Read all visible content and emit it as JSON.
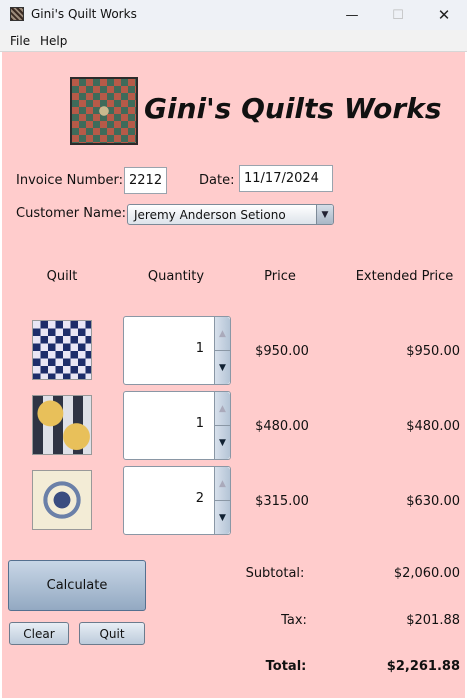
{
  "window": {
    "title": "Gini's Quilt Works"
  },
  "menu": [
    "File",
    "Help"
  ],
  "brand": {
    "title": "Gini's Quilts Works"
  },
  "invoice": {
    "number_label": "Invoice Number:",
    "number_value": "2212",
    "date_label": "Date:",
    "date_value": "11/17/2024",
    "customer_label": "Customer Name:",
    "customer_value": "Jeremy Anderson Setiono"
  },
  "columns": [
    "Quilt",
    "Quantity",
    "Price",
    "Extended Price"
  ],
  "items": [
    {
      "qty": "1",
      "price": "$950.00",
      "extended": "$950.00"
    },
    {
      "qty": "1",
      "price": "$480.00",
      "extended": "$480.00"
    },
    {
      "qty": "2",
      "price": "$315.00",
      "extended": "$630.00"
    }
  ],
  "buttons": {
    "calculate": "Calculate",
    "clear": "Clear",
    "quit": "Quit"
  },
  "totals": {
    "subtotal_label": "Subtotal:",
    "subtotal_value": "$2,060.00",
    "tax_label": "Tax:",
    "tax_value": "$201.88",
    "total_label": "Total:",
    "total_value": "$2,261.88"
  }
}
